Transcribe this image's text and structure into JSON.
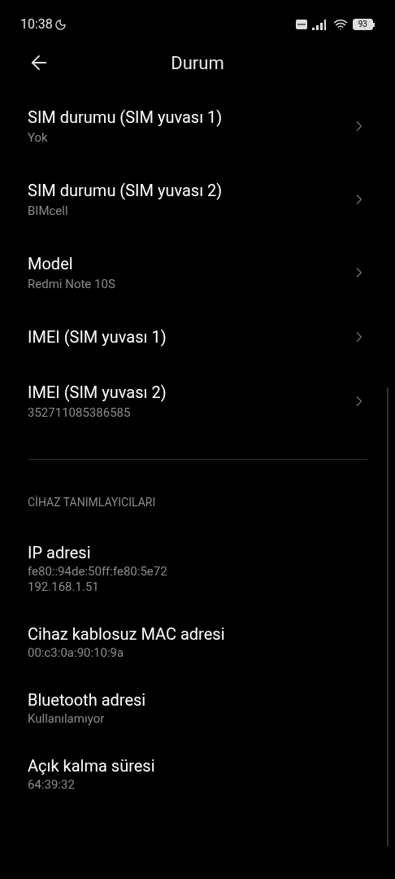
{
  "status_bar": {
    "time": "10:38",
    "battery": "93"
  },
  "header": {
    "title": "Durum"
  },
  "items": [
    {
      "title": "SIM durumu (SIM yuvası 1)",
      "subtitle": "Yok"
    },
    {
      "title": "SIM durumu (SIM yuvası 2)",
      "subtitle": "BIMcell"
    },
    {
      "title": "Model",
      "subtitle": "Redmi Note 10S"
    },
    {
      "title": "IMEI (SIM yuvası 1)"
    },
    {
      "title": "IMEI (SIM yuvası 2)",
      "subtitle": "352711085386585"
    }
  ],
  "section": {
    "heading": "CİHAZ TANIMLAYICILARI",
    "items": [
      {
        "title": "IP adresi",
        "lines": [
          "fe80::94de:50ff:fe80:5e72",
          "192.168.1.51"
        ]
      },
      {
        "title": "Cihaz kablosuz MAC adresi",
        "lines": [
          "00:c3:0a:90:10:9a"
        ]
      },
      {
        "title": "Bluetooth adresi",
        "lines": [
          "Kullanılamıyor"
        ]
      },
      {
        "title": "Açık kalma süresi",
        "lines": [
          "64:39:32"
        ]
      }
    ]
  }
}
